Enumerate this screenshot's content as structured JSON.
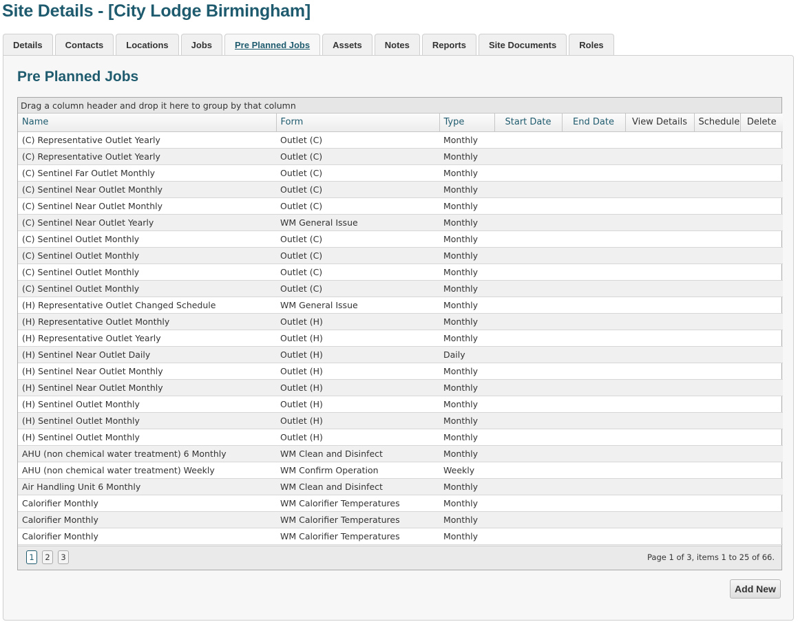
{
  "page": {
    "title": "Site Details - [City Lodge Birmingham]"
  },
  "tabs": [
    "Details",
    "Contacts",
    "Locations",
    "Jobs",
    "Pre Planned Jobs",
    "Assets",
    "Notes",
    "Reports",
    "Site Documents",
    "Roles"
  ],
  "active_tab": "Pre Planned Jobs",
  "section_title": "Pre Planned Jobs",
  "grid": {
    "group_hint": "Drag a column header and drop it here to group by that column",
    "columns": {
      "name": "Name",
      "form": "Form",
      "type": "Type",
      "start_date": "Start Date",
      "end_date": "End Date",
      "view_details": "View Details",
      "schedule": "Schedule",
      "delete": "Delete"
    },
    "rows": [
      {
        "name": "(C) Representative Outlet Yearly",
        "form": "Outlet (C)",
        "type": "Monthly"
      },
      {
        "name": "(C) Representative Outlet Yearly",
        "form": "Outlet (C)",
        "type": "Monthly"
      },
      {
        "name": "(C) Sentinel Far Outlet Monthly",
        "form": "Outlet (C)",
        "type": "Monthly"
      },
      {
        "name": "(C) Sentinel Near Outlet Monthly",
        "form": "Outlet (C)",
        "type": "Monthly"
      },
      {
        "name": "(C) Sentinel Near Outlet Monthly",
        "form": "Outlet (C)",
        "type": "Monthly"
      },
      {
        "name": "(C) Sentinel Near Outlet Yearly",
        "form": "WM General Issue",
        "type": "Monthly"
      },
      {
        "name": "(C) Sentinel Outlet Monthly",
        "form": "Outlet (C)",
        "type": "Monthly"
      },
      {
        "name": "(C) Sentinel Outlet Monthly",
        "form": "Outlet (C)",
        "type": "Monthly"
      },
      {
        "name": "(C) Sentinel Outlet Monthly",
        "form": "Outlet (C)",
        "type": "Monthly"
      },
      {
        "name": "(C) Sentinel Outlet Monthly",
        "form": "Outlet (C)",
        "type": "Monthly"
      },
      {
        "name": "(H) Representative Outlet Changed Schedule",
        "form": "WM General Issue",
        "type": "Monthly"
      },
      {
        "name": "(H) Representative Outlet Monthly",
        "form": "Outlet (H)",
        "type": "Monthly"
      },
      {
        "name": "(H) Representative Outlet Yearly",
        "form": "Outlet (H)",
        "type": "Monthly"
      },
      {
        "name": "(H) Sentinel Near Outlet Daily",
        "form": "Outlet (H)",
        "type": "Daily"
      },
      {
        "name": "(H) Sentinel Near Outlet Monthly",
        "form": "Outlet (H)",
        "type": "Monthly"
      },
      {
        "name": "(H) Sentinel Near Outlet Monthly",
        "form": "Outlet (H)",
        "type": "Monthly"
      },
      {
        "name": "(H) Sentinel Outlet Monthly",
        "form": "Outlet (H)",
        "type": "Monthly"
      },
      {
        "name": "(H) Sentinel Outlet Monthly",
        "form": "Outlet (H)",
        "type": "Monthly"
      },
      {
        "name": "(H) Sentinel Outlet Monthly",
        "form": "Outlet (H)",
        "type": "Monthly"
      },
      {
        "name": "AHU (non chemical water treatment) 6 Monthly",
        "form": "WM Clean and Disinfect",
        "type": "Monthly"
      },
      {
        "name": "AHU (non chemical water treatment) Weekly",
        "form": "WM Confirm Operation",
        "type": "Weekly"
      },
      {
        "name": "Air Handling Unit 6 Monthly",
        "form": "WM Clean and Disinfect",
        "type": "Monthly"
      },
      {
        "name": "Calorifier Monthly",
        "form": "WM Calorifier Temperatures",
        "type": "Monthly"
      },
      {
        "name": "Calorifier Monthly",
        "form": "WM Calorifier Temperatures",
        "type": "Monthly"
      },
      {
        "name": "Calorifier Monthly",
        "form": "WM Calorifier Temperatures",
        "type": "Monthly"
      }
    ]
  },
  "pager": {
    "pages": [
      "1",
      "2",
      "3"
    ],
    "current_page": "1",
    "info": {
      "prefix": "Page ",
      "page": "1",
      "of": " of 3, items ",
      "from": "1",
      "to_word": " to ",
      "to": "25",
      "of_total": " of 66."
    }
  },
  "add_new_label": "Add New"
}
